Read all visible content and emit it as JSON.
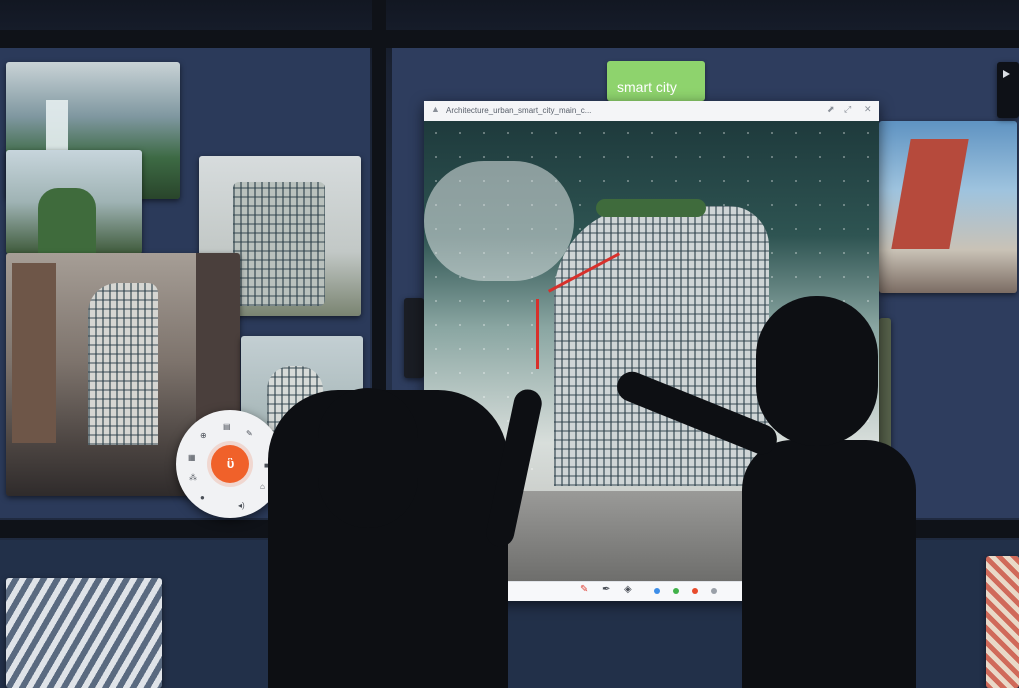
{
  "window": {
    "filename": "Architecture_urban_smart_city_main_c...",
    "toolbar_colors": [
      "#3d8ee8",
      "#41b24a",
      "#e84b2c",
      "#9aa0a8"
    ]
  },
  "tag": {
    "label": "smart city",
    "color": "#8ed36d"
  },
  "launcher": {
    "logo": "ὓ",
    "accent": "#f0612a",
    "icons": [
      "search-icon",
      "note-icon",
      "pen-icon",
      "grid-icon",
      "lock-icon",
      "apps-icon",
      "home-icon",
      "chat-icon",
      "volume-icon"
    ]
  }
}
